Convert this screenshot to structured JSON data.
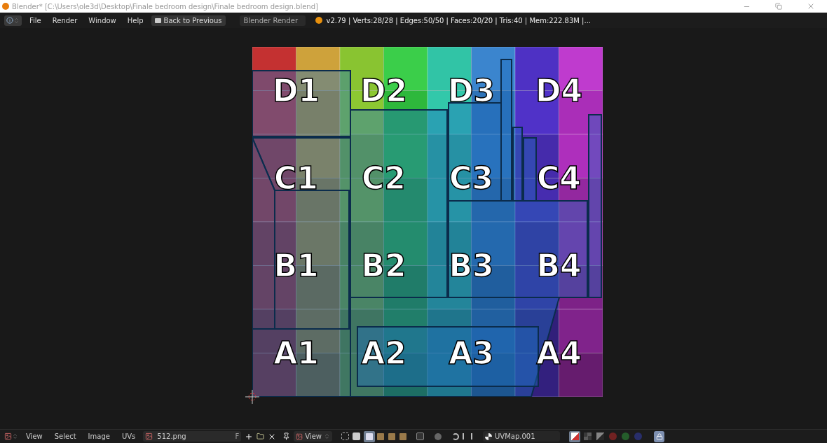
{
  "window": {
    "title": "Blender* [C:\\Users\\ole3d\\Desktop\\Finale bedroom design\\Finale bedroom design.blend]"
  },
  "info_header": {
    "menus": [
      "File",
      "Render",
      "Window",
      "Help"
    ],
    "back_button": "Back to Previous",
    "render_engine": "Blender Render",
    "stats": "v2.79 | Verts:28/28 | Edges:50/50 | Faces:20/20 | Tris:40 | Mem:222.83M |..."
  },
  "uv_grid": {
    "labels": [
      "D1",
      "D2",
      "D3",
      "D4",
      "C1",
      "C2",
      "C3",
      "C4",
      "B1",
      "B2",
      "B3",
      "B4",
      "A1",
      "A2",
      "A3",
      "A4"
    ]
  },
  "image_editor_header": {
    "menus": [
      "View",
      "Select",
      "Image",
      "UVs"
    ],
    "image_name": "512.png",
    "fake_user": "F",
    "view_mode": "View",
    "uv_map": "UVMap.001",
    "select_modes": [
      {
        "selected": true
      },
      {
        "selected": false
      },
      {
        "selected": false
      },
      {
        "selected": false
      }
    ],
    "display_channels": [
      {
        "selected": true
      },
      {
        "selected": false
      },
      {
        "selected": false
      },
      {
        "selected": false
      },
      {
        "selected": false
      },
      {
        "selected": false
      }
    ],
    "lock": {
      "selected": true
    }
  }
}
